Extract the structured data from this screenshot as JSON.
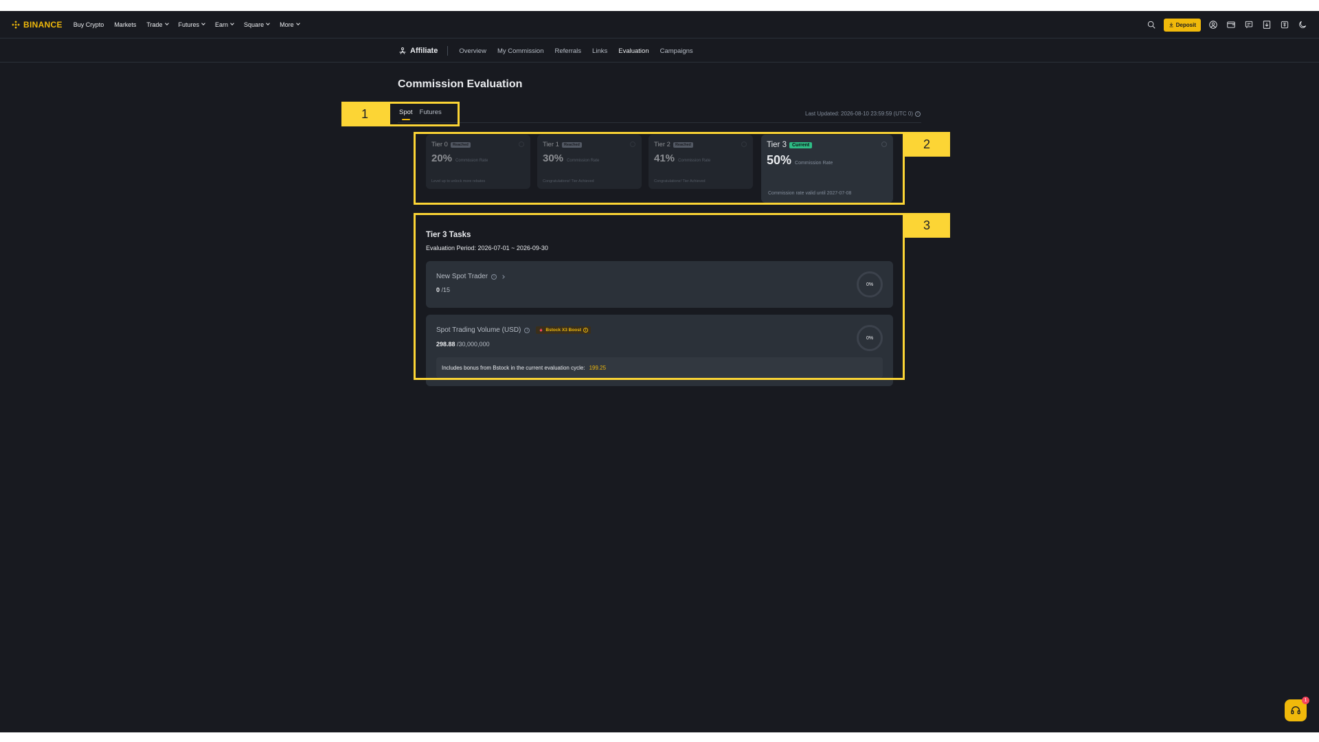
{
  "brand": {
    "name": "BINANCE"
  },
  "topnav": {
    "items": [
      {
        "label": "Buy Crypto",
        "caret": false
      },
      {
        "label": "Markets",
        "caret": false
      },
      {
        "label": "Trade",
        "caret": true
      },
      {
        "label": "Futures",
        "caret": true
      },
      {
        "label": "Earn",
        "caret": true
      },
      {
        "label": "Square",
        "caret": true
      },
      {
        "label": "More",
        "caret": true
      }
    ],
    "deposit_label": "Deposit"
  },
  "subnav": {
    "title": "Affiliate",
    "items": [
      "Overview",
      "My Commission",
      "Referrals",
      "Links",
      "Evaluation",
      "Campaigns"
    ],
    "active": "Evaluation"
  },
  "page": {
    "title": "Commission Evaluation"
  },
  "tabs": {
    "items": [
      "Spot",
      "Futures"
    ],
    "active": "Spot"
  },
  "last_updated": "Last Updated: 2026-08-10 23:59:59 (UTC 0)",
  "tiers": [
    {
      "name": "Tier 0",
      "badge": "Reached",
      "rate": "20%",
      "rate_label": "Commission Rate",
      "note": "Level up to unlock more rebates"
    },
    {
      "name": "Tier 1",
      "badge": "Reached",
      "rate": "30%",
      "rate_label": "Commission Rate",
      "note": "Congratulations! Tier Achieved"
    },
    {
      "name": "Tier 2",
      "badge": "Reached",
      "rate": "41%",
      "rate_label": "Commission Rate",
      "note": "Congratulations! Tier Achieved"
    },
    {
      "name": "Tier 3",
      "badge": "Current",
      "rate": "50%",
      "rate_label": "Commission Rate",
      "note": "Commission rate valid until 2027-07-08"
    }
  ],
  "tasks": {
    "title": "Tier 3 Tasks",
    "period": "Evaluation Period:  2026-07-01 ~ 2026-09-30",
    "items": [
      {
        "name": "New Spot Trader",
        "current": "0",
        "target": " /15",
        "percent_label": "0%"
      },
      {
        "name": "Spot Trading Volume (USD)",
        "boost": "Bstock X3 Boost",
        "current": "298.88",
        "target": " /30,000,000",
        "percent_label": "0%",
        "bonus_text": "Includes bonus from Bstock in the current evaluation cycle:",
        "bonus_amount": "199.25"
      }
    ]
  },
  "annotations": [
    "1",
    "2",
    "3"
  ],
  "support": {
    "badge_count": "1"
  },
  "colors": {
    "accent": "#f0b90b",
    "bg": "#181a20",
    "card": "#2b3139",
    "annotation": "#fcd535",
    "current_badge": "#2ebd85"
  }
}
